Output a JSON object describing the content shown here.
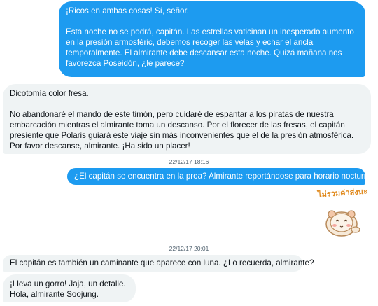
{
  "messages": [
    {
      "direction": "outgoing",
      "text": "¡Ricos en ambas cosas! Sí, señor.\n\nEsta noche no se podrá, capitán. Las estrellas vaticinan un inesperado aumento en la presión armosféric, debemos recoger las velas y echar el ancla temporalmente. El almirante debe descansar esta noche. Quizá mañana nos favorezca Poseidón, ¿le parece?"
    },
    {
      "direction": "incoming",
      "text": "Dicotomía color fresa.\n\nNo abandonaré el mando de este timón, pero cuidaré de espantar a los piratas de nuestra embarcación mientras el almirante toma un descanso. Por el florecer de las fresas, el capitán presiente que Polaris guiará este viaje sin más inconvenientes que el de la presión atmosférica. Por favor descanse, almirante. ¡Ha sido un placer!"
    },
    {
      "timestamp": "22/12/17 18:16"
    },
    {
      "direction": "outgoing",
      "text": "¿El capitán se encuentra en la proa? Almirante reportándose para horario nocturno."
    },
    {
      "sticker": {
        "icon": "hamster-sticker-icon",
        "caption": "ไม่รวมค่าส่งนะ",
        "caption_color": "#e08a1e"
      }
    },
    {
      "timestamp": "22/12/17 20:01"
    },
    {
      "direction": "incoming",
      "text": "El capitán es también un caminante que aparece con luna. ¿Lo recuerda, almirante?"
    },
    {
      "direction": "incoming",
      "text": "¡Lleva un gorro! Jaja, un detalle.\nHola, almirante Soojung."
    }
  ],
  "colors": {
    "outgoing_bubble": "#1d9bf0",
    "incoming_bubble": "#eff3f4",
    "timestamp_text": "#536471"
  }
}
